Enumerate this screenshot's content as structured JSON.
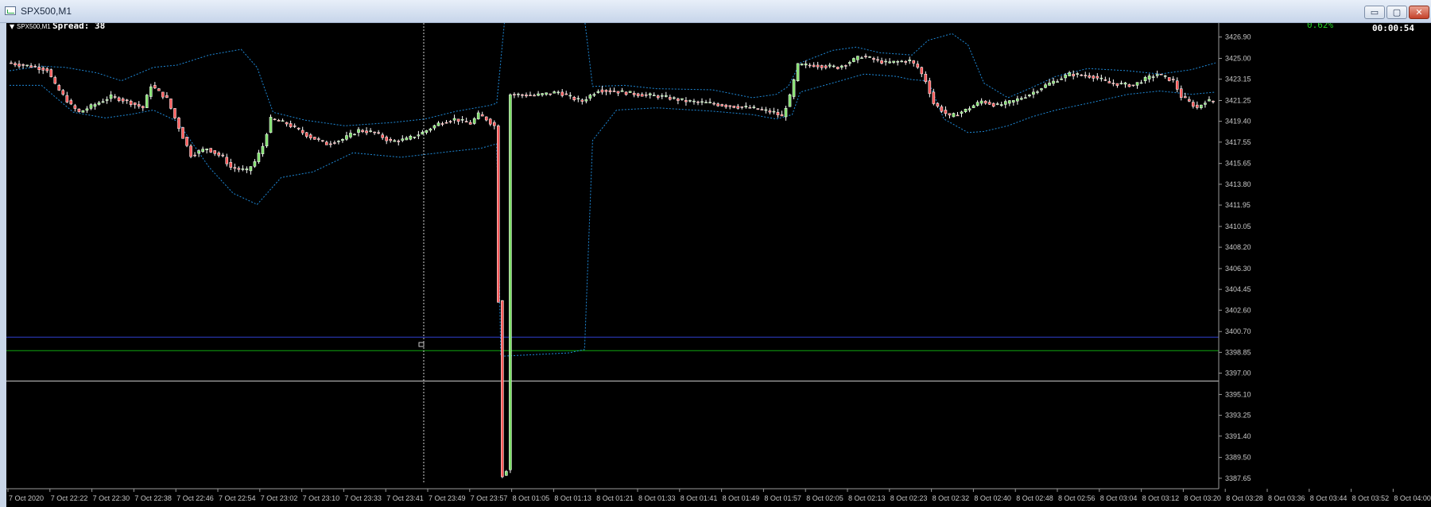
{
  "window": {
    "title": "SPX500,M1",
    "minimize_icon": "minimize-icon",
    "maximize_icon": "maximize-icon",
    "close_icon": "close-icon",
    "min_glyph": "▭",
    "max_glyph": "▢",
    "close_glyph": "✕"
  },
  "chart_header": {
    "symbol_label": "SPX500,M1",
    "spread_text": "Spread: 38",
    "percent_text": "0.62%",
    "countdown_text": "00:00:54"
  },
  "colors": {
    "background": "#000000",
    "bull_candle": "#7fe06a",
    "bear_candle": "#ff5a5a",
    "bollinger": "#1e88d6",
    "blue_line": "#2f3fd0",
    "green_line": "#11a511",
    "white_line": "#c8c8c8",
    "axis_text": "#c8c8c8",
    "percent_text": "#22d122"
  },
  "chart_data": {
    "type": "candlestick",
    "symbol": "SPX500",
    "timeframe": "M1",
    "ylim": [
      3387.0,
      3428.0
    ],
    "y_ticks": [
      "3426.90",
      "3425.00",
      "3423.15",
      "3421.25",
      "3419.40",
      "3417.55",
      "3415.65",
      "3413.80",
      "3411.95",
      "3410.05",
      "3408.20",
      "3406.30",
      "3404.45",
      "3402.60",
      "3400.70",
      "3398.85",
      "3397.00",
      "3395.10",
      "3393.25",
      "3391.40",
      "3389.50",
      "3387.65"
    ],
    "x_ticks": [
      "7 Oct 2020",
      "7 Oct 22:22",
      "7 Oct 22:30",
      "7 Oct 22:38",
      "7 Oct 22:46",
      "7 Oct 22:54",
      "7 Oct 23:02",
      "7 Oct 23:10",
      "7 Oct 23:33",
      "7 Oct 23:41",
      "7 Oct 23:49",
      "7 Oct 23:57",
      "8 Oct 01:05",
      "8 Oct 01:13",
      "8 Oct 01:21",
      "8 Oct 01:33",
      "8 Oct 01:41",
      "8 Oct 01:49",
      "8 Oct 01:57",
      "8 Oct 02:05",
      "8 Oct 02:13",
      "8 Oct 02:23",
      "8 Oct 02:32",
      "8 Oct 02:40",
      "8 Oct 02:48",
      "8 Oct 02:56",
      "8 Oct 03:04",
      "8 Oct 03:12",
      "8 Oct 03:20",
      "8 Oct 03:28",
      "8 Oct 03:36",
      "8 Oct 03:44",
      "8 Oct 03:52",
      "8 Oct 04:00"
    ],
    "price_path": [
      [
        0,
        3424.6
      ],
      [
        6,
        3424.3
      ],
      [
        10,
        3424.0
      ],
      [
        12,
        3422.6
      ],
      [
        16,
        3420.8
      ],
      [
        18,
        3420.2
      ],
      [
        22,
        3420.9
      ],
      [
        26,
        3421.6
      ],
      [
        30,
        3421.2
      ],
      [
        34,
        3420.6
      ],
      [
        36,
        3422.6
      ],
      [
        40,
        3421.4
      ],
      [
        44,
        3418.0
      ],
      [
        46,
        3416.4
      ],
      [
        50,
        3417.0
      ],
      [
        54,
        3416.2
      ],
      [
        56,
        3415.3
      ],
      [
        60,
        3415.0
      ],
      [
        62,
        3415.8
      ],
      [
        64,
        3417.2
      ],
      [
        66,
        3419.6
      ],
      [
        70,
        3419.2
      ],
      [
        76,
        3418.0
      ],
      [
        80,
        3417.4
      ],
      [
        84,
        3417.8
      ],
      [
        88,
        3418.6
      ],
      [
        92,
        3418.4
      ],
      [
        96,
        3417.6
      ],
      [
        100,
        3417.8
      ],
      [
        104,
        3418.4
      ],
      [
        108,
        3419.2
      ],
      [
        112,
        3419.6
      ],
      [
        116,
        3419.2
      ],
      [
        118,
        3420.0
      ],
      [
        120,
        3419.6
      ],
      [
        122,
        3419.0
      ],
      [
        124,
        3387.9
      ],
      [
        125,
        3388.4
      ],
      [
        126,
        3421.8
      ],
      [
        132,
        3421.7
      ],
      [
        138,
        3422.0
      ],
      [
        142,
        3421.4
      ],
      [
        144,
        3421.2
      ],
      [
        148,
        3422.2
      ],
      [
        154,
        3422.0
      ],
      [
        158,
        3421.8
      ],
      [
        164,
        3421.6
      ],
      [
        170,
        3421.2
      ],
      [
        176,
        3421.0
      ],
      [
        180,
        3420.8
      ],
      [
        186,
        3420.6
      ],
      [
        192,
        3420.2
      ],
      [
        194,
        3419.8
      ],
      [
        196,
        3421.6
      ],
      [
        198,
        3424.4
      ],
      [
        202,
        3424.4
      ],
      [
        208,
        3424.2
      ],
      [
        214,
        3425.2
      ],
      [
        220,
        3424.6
      ],
      [
        226,
        3424.8
      ],
      [
        228,
        3424.2
      ],
      [
        230,
        3423.0
      ],
      [
        232,
        3421.0
      ],
      [
        236,
        3419.8
      ],
      [
        240,
        3420.4
      ],
      [
        244,
        3421.2
      ],
      [
        248,
        3420.8
      ],
      [
        252,
        3421.2
      ],
      [
        256,
        3421.8
      ],
      [
        260,
        3422.6
      ],
      [
        266,
        3423.6
      ],
      [
        272,
        3423.4
      ],
      [
        276,
        3422.8
      ],
      [
        282,
        3422.6
      ],
      [
        284,
        3423.0
      ],
      [
        288,
        3423.6
      ],
      [
        292,
        3423.0
      ],
      [
        294,
        3421.6
      ],
      [
        298,
        3420.6
      ],
      [
        300,
        3421.2
      ]
    ],
    "bollinger": {
      "upper": [
        [
          0,
          3423.9
        ],
        [
          8,
          3424.3
        ],
        [
          14,
          3424.2
        ],
        [
          22,
          3423.7
        ],
        [
          28,
          3423.0
        ],
        [
          36,
          3424.2
        ],
        [
          42,
          3424.4
        ],
        [
          50,
          3425.3
        ],
        [
          58,
          3425.8
        ],
        [
          62,
          3424.2
        ],
        [
          66,
          3420.2
        ],
        [
          74,
          3419.5
        ],
        [
          84,
          3419.0
        ],
        [
          96,
          3419.3
        ],
        [
          104,
          3419.6
        ],
        [
          112,
          3420.3
        ],
        [
          120,
          3420.8
        ],
        [
          122,
          3421.0
        ],
        [
          124,
          3428.5
        ],
        [
          144,
          3428.5
        ],
        [
          146,
          3422.5
        ],
        [
          154,
          3422.6
        ],
        [
          162,
          3422.3
        ],
        [
          176,
          3422.2
        ],
        [
          186,
          3421.5
        ],
        [
          192,
          3421.8
        ],
        [
          195,
          3422.5
        ],
        [
          198,
          3424.6
        ],
        [
          206,
          3425.7
        ],
        [
          212,
          3426.0
        ],
        [
          218,
          3425.5
        ],
        [
          226,
          3425.3
        ],
        [
          230,
          3426.6
        ],
        [
          236,
          3427.2
        ],
        [
          240,
          3426.2
        ],
        [
          244,
          3422.8
        ],
        [
          250,
          3421.5
        ],
        [
          256,
          3422.4
        ],
        [
          262,
          3423.4
        ],
        [
          270,
          3424.1
        ],
        [
          280,
          3423.9
        ],
        [
          288,
          3423.6
        ],
        [
          296,
          3424.0
        ],
        [
          302,
          3424.6
        ]
      ],
      "middle": [
        [
          0,
          3424.4
        ],
        [
          10,
          3424.2
        ],
        [
          18,
          3422.8
        ],
        [
          24,
          3421.6
        ],
        [
          30,
          3421.8
        ],
        [
          36,
          3422.4
        ],
        [
          40,
          3421.6
        ],
        [
          46,
          3418.8
        ],
        [
          52,
          3417.0
        ],
        [
          58,
          3416.2
        ],
        [
          64,
          3417.6
        ],
        [
          70,
          3418.6
        ],
        [
          80,
          3418.0
        ],
        [
          90,
          3418.2
        ],
        [
          100,
          3418.4
        ],
        [
          110,
          3419.0
        ],
        [
          120,
          3419.8
        ],
        [
          126,
          3421.5
        ],
        [
          140,
          3421.7
        ],
        [
          150,
          3421.6
        ],
        [
          160,
          3421.4
        ],
        [
          170,
          3421.2
        ],
        [
          180,
          3421.0
        ],
        [
          190,
          3420.6
        ],
        [
          198,
          3422.8
        ],
        [
          208,
          3424.2
        ],
        [
          218,
          3424.8
        ],
        [
          226,
          3424.5
        ],
        [
          232,
          3422.2
        ],
        [
          240,
          3420.8
        ],
        [
          248,
          3421.0
        ],
        [
          256,
          3421.6
        ],
        [
          264,
          3422.8
        ],
        [
          272,
          3423.2
        ],
        [
          282,
          3423.0
        ],
        [
          292,
          3423.2
        ],
        [
          300,
          3422.4
        ]
      ],
      "lower": [
        [
          0,
          3422.6
        ],
        [
          8,
          3422.6
        ],
        [
          16,
          3420.2
        ],
        [
          24,
          3419.7
        ],
        [
          30,
          3420.0
        ],
        [
          36,
          3420.4
        ],
        [
          42,
          3419.4
        ],
        [
          50,
          3415.3
        ],
        [
          56,
          3413.0
        ],
        [
          62,
          3412.0
        ],
        [
          68,
          3414.4
        ],
        [
          76,
          3414.9
        ],
        [
          86,
          3416.6
        ],
        [
          98,
          3416.2
        ],
        [
          110,
          3416.7
        ],
        [
          118,
          3417.0
        ],
        [
          122,
          3417.4
        ],
        [
          123,
          3398.5
        ],
        [
          140,
          3398.8
        ],
        [
          144,
          3399.1
        ],
        [
          146,
          3417.7
        ],
        [
          152,
          3420.4
        ],
        [
          162,
          3420.6
        ],
        [
          176,
          3420.3
        ],
        [
          186,
          3420.0
        ],
        [
          192,
          3419.6
        ],
        [
          196,
          3420.0
        ],
        [
          198,
          3422.0
        ],
        [
          206,
          3422.8
        ],
        [
          214,
          3423.6
        ],
        [
          222,
          3423.4
        ],
        [
          226,
          3423.1
        ],
        [
          230,
          3423.0
        ],
        [
          234,
          3419.6
        ],
        [
          240,
          3418.4
        ],
        [
          244,
          3418.5
        ],
        [
          250,
          3419.0
        ],
        [
          256,
          3419.8
        ],
        [
          262,
          3420.4
        ],
        [
          270,
          3421.0
        ],
        [
          280,
          3421.8
        ],
        [
          288,
          3422.1
        ],
        [
          296,
          3421.8
        ],
        [
          302,
          3422.0
        ]
      ]
    },
    "horizontal_lines": [
      {
        "price": 3400.2,
        "color": "blue"
      },
      {
        "price": 3399.0,
        "color": "green"
      },
      {
        "price": 3396.3,
        "color": "white"
      }
    ],
    "vertical_marker_label": "7 Oct 23:57",
    "grid": false
  }
}
